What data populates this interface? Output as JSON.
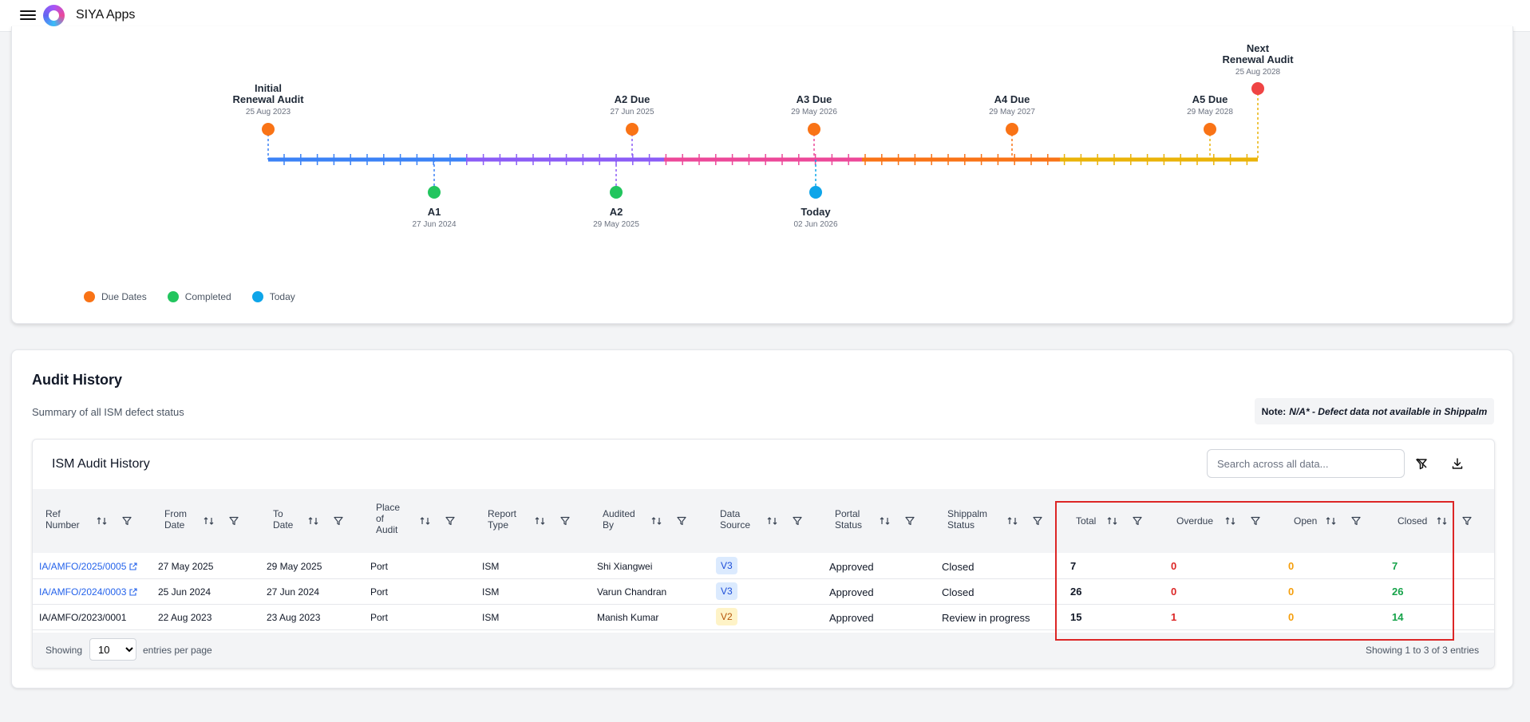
{
  "app": {
    "title": "SIYA Apps"
  },
  "timeline": {
    "milestones_top": [
      {
        "l1": "Initial",
        "l2": "Renewal Audit",
        "date": "25 Aug 2023"
      },
      {
        "l1": "A2 Due",
        "date": "27 Jun 2025"
      },
      {
        "l1": "A3 Due",
        "date": "29 May 2026"
      },
      {
        "l1": "A4 Due",
        "date": "29 May 2027"
      },
      {
        "l1": "A5 Due",
        "date": "29 May 2028"
      },
      {
        "l1": "Next",
        "l2": "Renewal Audit",
        "date": "25 Aug 2028"
      }
    ],
    "milestones_bottom": [
      {
        "label": "A1",
        "date": "27 Jun 2024"
      },
      {
        "label": "A2",
        "date": "29 May 2025"
      },
      {
        "label": "Today",
        "date": "02 Jun 2026"
      }
    ],
    "legend": [
      "Due Dates",
      "Completed",
      "Today"
    ],
    "colors": {
      "due": "#f97316",
      "completed": "#22c55e",
      "today": "#0ea5e9",
      "renewal": "#ef4444",
      "seg1": "#3b82f6",
      "seg2": "#8b5cf6",
      "seg3": "#ec4899",
      "seg4": "#f97316",
      "seg5": "#eab308"
    }
  },
  "history": {
    "title": "Audit History",
    "subtitle": "Summary of all ISM defect status",
    "note_label": "Note:",
    "note_text": "N/A* - Defect data not available in Shippalm",
    "table_title": "ISM Audit History",
    "search_placeholder": "Search across all data...",
    "columns": {
      "ref": [
        "Ref",
        "Number"
      ],
      "from": [
        "From",
        "Date"
      ],
      "to": [
        "To",
        "Date"
      ],
      "place": [
        "Place",
        "of",
        "Audit"
      ],
      "report": [
        "Report",
        "Type"
      ],
      "audited": [
        "Audited",
        "By"
      ],
      "source": [
        "Data",
        "Source"
      ],
      "portal": [
        "Portal",
        "Status"
      ],
      "shippalm": [
        "Shippalm",
        "Status"
      ],
      "total": "Total",
      "overdue": "Overdue",
      "open": "Open",
      "closed": "Closed"
    },
    "rows": [
      {
        "ref": "IA/AMFO/2025/0005",
        "from": "27 May 2025",
        "to": "29 May 2025",
        "place": "Port",
        "report": "ISM",
        "audited": "Shi Xiangwei",
        "source": "V3",
        "portal": "Approved",
        "shippalm": "Closed",
        "total": "7",
        "overdue": "0",
        "open": "0",
        "closed": "7"
      },
      {
        "ref": "IA/AMFO/2024/0003",
        "from": "25 Jun 2024",
        "to": "27 Jun 2024",
        "place": "Port",
        "report": "ISM",
        "audited": "Varun Chandran",
        "source": "V3",
        "portal": "Approved",
        "shippalm": "Closed",
        "total": "26",
        "overdue": "0",
        "open": "0",
        "closed": "26"
      },
      {
        "ref": "IA/AMFO/2023/0001",
        "from": "22 Aug 2023",
        "to": "23 Aug 2023",
        "place": "Port",
        "report": "ISM",
        "audited": "Manish Kumar",
        "source": "V2",
        "portal": "Approved",
        "shippalm": "Review in progress",
        "total": "15",
        "overdue": "1",
        "open": "0",
        "closed": "14"
      }
    ],
    "footer": {
      "showing": "Showing",
      "per_page": "10",
      "per_page_suffix": "entries per page",
      "summary": "Showing 1 to 3 of 3 entries"
    }
  }
}
